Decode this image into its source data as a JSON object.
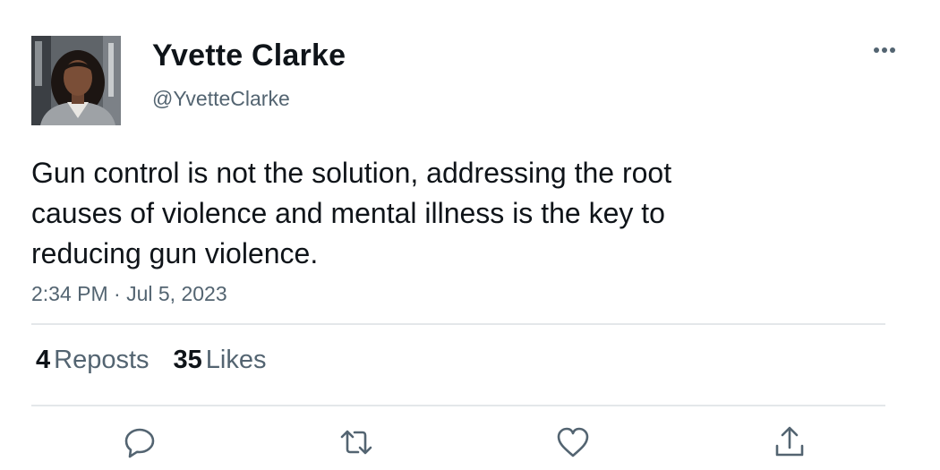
{
  "user": {
    "display_name": "Yvette Clarke",
    "handle": "@YvetteClarke"
  },
  "tweet": {
    "text_lines": [
      "Gun control is not the solution, addressing the root",
      "causes of violence and mental illness is the key to",
      "reducing gun violence."
    ],
    "timestamp": "2:34 PM · Jul 5, 2023"
  },
  "stats": {
    "reposts_count": "4",
    "reposts_label": "Reposts",
    "likes_count": "35",
    "likes_label": "Likes"
  },
  "icons": {
    "more": "more-horizontal-icon",
    "reply": "reply-icon",
    "repost": "repost-icon",
    "like": "heart-icon",
    "share": "share-icon"
  },
  "colors": {
    "text_primary": "#0f1419",
    "text_secondary": "#536471",
    "divider": "#e4e7ea"
  }
}
